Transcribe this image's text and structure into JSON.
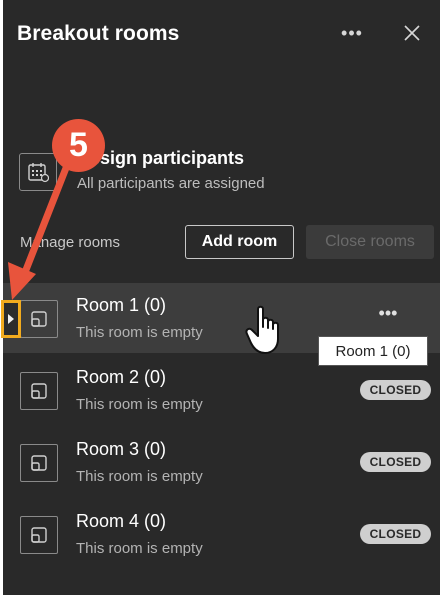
{
  "header": {
    "title": "Breakout rooms",
    "more_icon": "more-horizontal-icon",
    "close_icon": "close-icon",
    "more_glyph": "•••",
    "close_glyph": "✕"
  },
  "assign": {
    "title": "Assign participants",
    "subtitle": "All participants are assigned",
    "icon": "calendar-grid-icon"
  },
  "manage": {
    "label": "Manage rooms",
    "add_room_label": "Add room",
    "close_rooms_label": "Close rooms"
  },
  "rooms": [
    {
      "name": "Room 1 (0)",
      "status": "This room is empty",
      "badge": "",
      "hovered": true
    },
    {
      "name": "Room 2 (0)",
      "status": "This room is empty",
      "badge": "CLOSED",
      "hovered": false
    },
    {
      "name": "Room 3 (0)",
      "status": "This room is empty",
      "badge": "CLOSED",
      "hovered": false
    },
    {
      "name": "Room 4 (0)",
      "status": "This room is empty",
      "badge": "CLOSED",
      "hovered": false
    }
  ],
  "room_more_glyph": "•••",
  "tooltip": "Room 1 (0)",
  "annotation": {
    "step_number": "5",
    "color": "#e8543c",
    "highlight_color": "#f2ab1e"
  }
}
